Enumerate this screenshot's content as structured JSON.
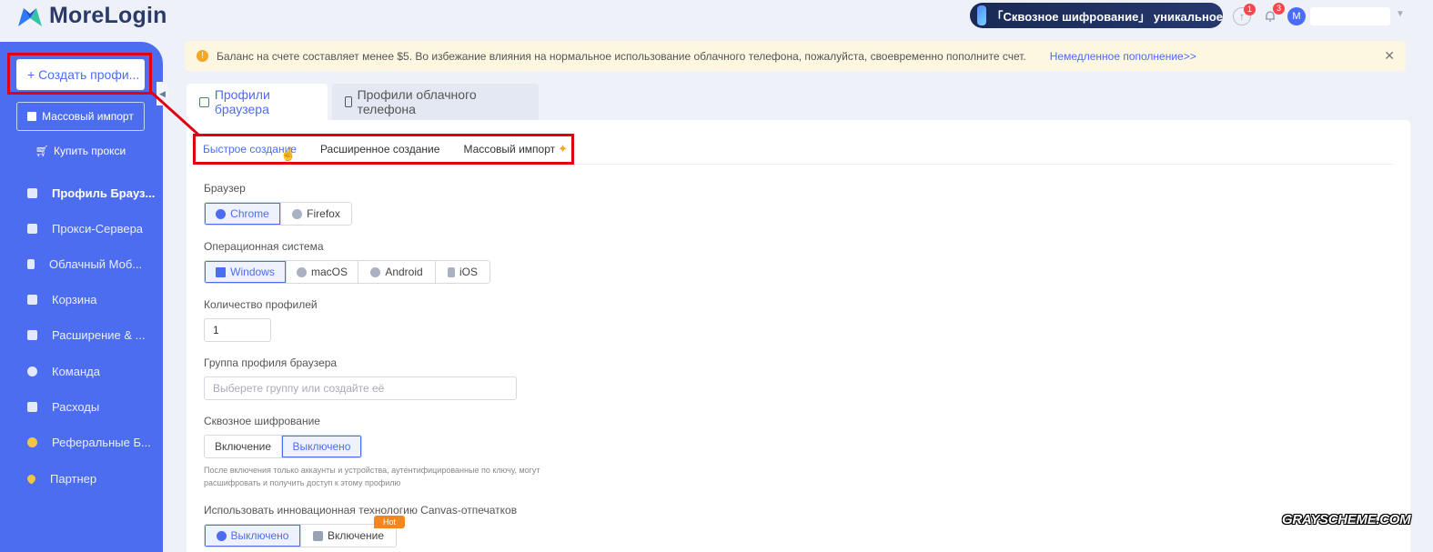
{
  "app": {
    "title": "MoreLogin"
  },
  "topbar": {
    "promo_text": "「Сквозное шифрование」 уникальное",
    "upgrade_badge": "1",
    "notifications_badge": "3",
    "avatar_letter": "M"
  },
  "sidebar": {
    "create_label": "+ Создать профи...",
    "import_label": "Массовый импорт",
    "buy_proxy_label": "Купить прокси",
    "items": [
      {
        "label": "Профиль Брауз...",
        "icon": "browser-icon"
      },
      {
        "label": "Прокси-Сервера",
        "icon": "server-icon"
      },
      {
        "label": "Облачный Моб...",
        "icon": "phone-icon"
      },
      {
        "label": "Корзина",
        "icon": "trash-icon"
      },
      {
        "label": "Расширение & ...",
        "icon": "puzzle-icon"
      },
      {
        "label": "Команда",
        "icon": "team-icon"
      },
      {
        "label": "Расходы",
        "icon": "wallet-icon"
      },
      {
        "label": "Реферальные Б...",
        "icon": "coin-icon"
      },
      {
        "label": "Партнер",
        "icon": "heart-icon"
      }
    ]
  },
  "alert": {
    "text": "Баланс на счете составляет менее $5. Во избежание влияния на нормальное использование облачного телефона, пожалуйста, своевременно пополните счет.",
    "link": "Немедленное пополнение>>"
  },
  "tabs": {
    "browser": "Профили браузера",
    "cloud_phone": "Профили облачного телефона"
  },
  "subtabs": {
    "quick": "Быстрое создание",
    "advanced": "Расширенное создание",
    "bulk": "Массовый импорт"
  },
  "form": {
    "browser_label": "Браузер",
    "browser_options": [
      "Chrome",
      "Firefox"
    ],
    "browser_selected": "Chrome",
    "os_label": "Операционная система",
    "os_options": [
      "Windows",
      "macOS",
      "Android",
      "iOS"
    ],
    "os_selected": "Windows",
    "count_label": "Количество профилей",
    "count_value": "1",
    "group_label": "Группа профиля браузера",
    "group_placeholder": "Выберете группу или создайте её",
    "encryption_label": "Сквозное шифрование",
    "encryption_on": "Включение",
    "encryption_off": "Выключено",
    "encryption_hint": "После включения только аккаунты и устройства, аутентифицированные по ключу, могут расшифровать и получить доступ к этому профилю",
    "canvas_label": "Использовать инновационная технологию Canvas-отпечатков",
    "canvas_off": "Выключено",
    "canvas_on": "Включение",
    "hot_badge": "Hot"
  },
  "watermark": "GRAYSCHEME.COM",
  "colors": {
    "accent": "#4d6df1",
    "sidebar": "#4d6df1",
    "annotation": "#e00012",
    "alert_bg": "#fdf6e0"
  }
}
